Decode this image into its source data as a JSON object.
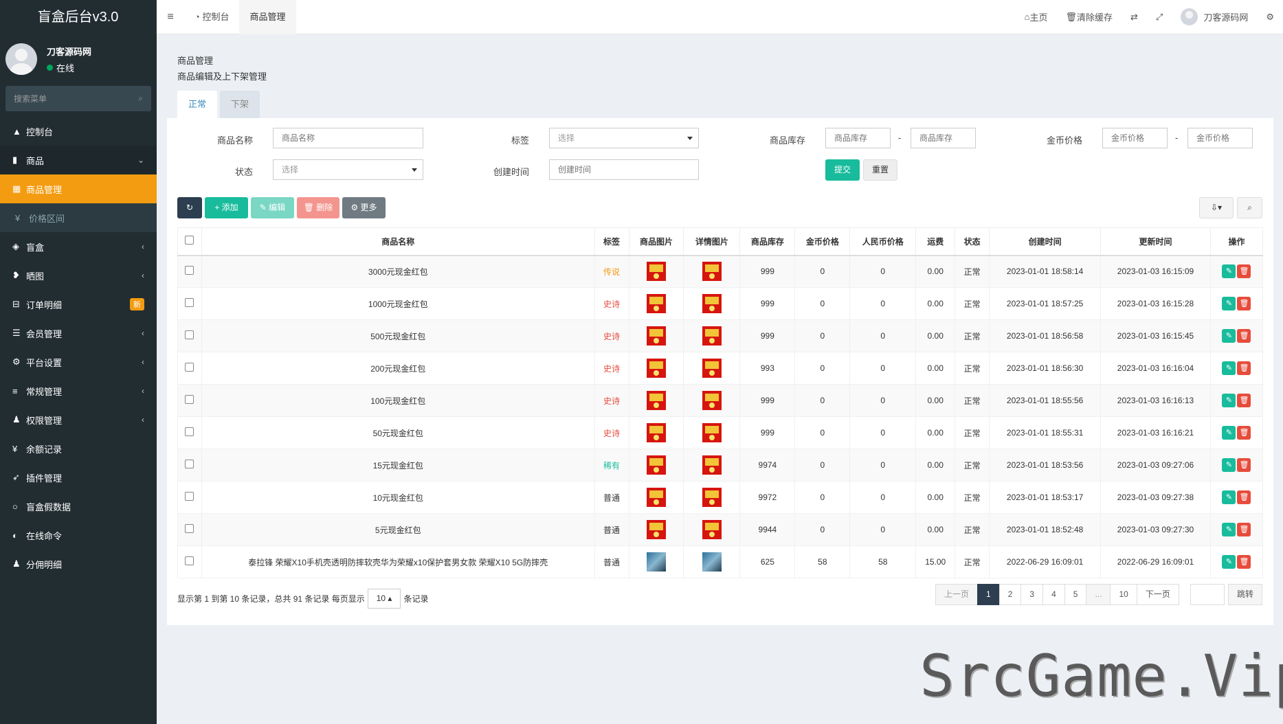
{
  "sidebar": {
    "app_title": "盲盒后台v3.0",
    "user_name": "刀客源码网",
    "user_status": "在线",
    "search_placeholder": "搜索菜单",
    "items": [
      {
        "icon": "▲",
        "label": "控制台",
        "arrow": ""
      },
      {
        "icon": "▮",
        "label": "商品",
        "arrow": "⌄"
      },
      {
        "icon": "▦",
        "label": "商品管理",
        "arrow": ""
      },
      {
        "icon": "¥",
        "label": "价格区间",
        "arrow": ""
      },
      {
        "icon": "◈",
        "label": "盲盒",
        "arrow": "‹"
      },
      {
        "icon": "❥",
        "label": "晒图",
        "arrow": "‹"
      },
      {
        "icon": "⊟",
        "label": "订单明细",
        "badge": "新"
      },
      {
        "icon": "☰",
        "label": "会员管理",
        "arrow": "‹"
      },
      {
        "icon": "⚙",
        "label": "平台设置",
        "arrow": "‹"
      },
      {
        "icon": "≡",
        "label": "常规管理",
        "arrow": "‹"
      },
      {
        "icon": "♟",
        "label": "权限管理",
        "arrow": "‹"
      },
      {
        "icon": "¥",
        "label": "余额记录",
        "arrow": ""
      },
      {
        "icon": "➶",
        "label": "插件管理",
        "arrow": ""
      },
      {
        "icon": "○",
        "label": "盲盒假数据",
        "arrow": ""
      },
      {
        "icon": "◐",
        "label": "在线命令",
        "arrow": ""
      },
      {
        "icon": "♟",
        "label": "分佣明细",
        "arrow": ""
      }
    ]
  },
  "header": {
    "tabs": [
      {
        "label": "控制台"
      },
      {
        "label": "商品管理"
      }
    ],
    "home": "主页",
    "clear_cache": "清除缓存",
    "user": "刀客源码网"
  },
  "content": {
    "title": "商品管理",
    "subtitle": "商品编辑及上下架管理",
    "subtabs": [
      "正常",
      "下架"
    ]
  },
  "filters": {
    "name_label": "商品名称",
    "name_placeholder": "商品名称",
    "tag_label": "标签",
    "tag_value": "选择",
    "stock_label": "商品库存",
    "stock_placeholder": "商品库存",
    "gold_label": "金币价格",
    "gold_placeholder": "金币价格",
    "status_label": "状态",
    "status_value": "选择",
    "created_label": "创建时间",
    "created_placeholder": "创建时间",
    "submit": "提交",
    "reset": "重置",
    "dash": "-"
  },
  "toolbar": {
    "add": "+ 添加",
    "edit": "✎ 编辑",
    "delete": "🗑 删除",
    "more": "⚙ 更多"
  },
  "table": {
    "columns": [
      "商品名称",
      "标签",
      "商品图片",
      "详情图片",
      "商品库存",
      "金币价格",
      "人民币价格",
      "运费",
      "状态",
      "创建时间",
      "更新时间",
      "操作"
    ],
    "rows": [
      {
        "name": "3000元现金红包",
        "tag": "传说",
        "tag_color": "orange",
        "img": "red",
        "stock": "999",
        "gold": "0",
        "rmb": "0",
        "ship": "0.00",
        "status": "正常",
        "created": "2023-01-01 18:58:14",
        "updated": "2023-01-03 16:15:09"
      },
      {
        "name": "1000元现金红包",
        "tag": "史诗",
        "tag_color": "red",
        "img": "red",
        "stock": "999",
        "gold": "0",
        "rmb": "0",
        "ship": "0.00",
        "status": "正常",
        "created": "2023-01-01 18:57:25",
        "updated": "2023-01-03 16:15:28"
      },
      {
        "name": "500元现金红包",
        "tag": "史诗",
        "tag_color": "red",
        "img": "red",
        "stock": "999",
        "gold": "0",
        "rmb": "0",
        "ship": "0.00",
        "status": "正常",
        "created": "2023-01-01 18:56:58",
        "updated": "2023-01-03 16:15:45"
      },
      {
        "name": "200元现金红包",
        "tag": "史诗",
        "tag_color": "red",
        "img": "red",
        "stock": "993",
        "gold": "0",
        "rmb": "0",
        "ship": "0.00",
        "status": "正常",
        "created": "2023-01-01 18:56:30",
        "updated": "2023-01-03 16:16:04"
      },
      {
        "name": "100元现金红包",
        "tag": "史诗",
        "tag_color": "red",
        "img": "red",
        "stock": "999",
        "gold": "0",
        "rmb": "0",
        "ship": "0.00",
        "status": "正常",
        "created": "2023-01-01 18:55:56",
        "updated": "2023-01-03 16:16:13"
      },
      {
        "name": "50元现金红包",
        "tag": "史诗",
        "tag_color": "red",
        "img": "red",
        "stock": "999",
        "gold": "0",
        "rmb": "0",
        "ship": "0.00",
        "status": "正常",
        "created": "2023-01-01 18:55:31",
        "updated": "2023-01-03 16:16:21"
      },
      {
        "name": "15元现金红包",
        "tag": "稀有",
        "tag_color": "green",
        "img": "red",
        "stock": "9974",
        "gold": "0",
        "rmb": "0",
        "ship": "0.00",
        "status": "正常",
        "created": "2023-01-01 18:53:56",
        "updated": "2023-01-03 09:27:06"
      },
      {
        "name": "10元现金红包",
        "tag": "普通",
        "tag_color": "normal",
        "img": "red",
        "stock": "9972",
        "gold": "0",
        "rmb": "0",
        "ship": "0.00",
        "status": "正常",
        "created": "2023-01-01 18:53:17",
        "updated": "2023-01-03 09:27:38"
      },
      {
        "name": "5元现金红包",
        "tag": "普通",
        "tag_color": "normal",
        "img": "red",
        "stock": "9944",
        "gold": "0",
        "rmb": "0",
        "ship": "0.00",
        "status": "正常",
        "created": "2023-01-01 18:52:48",
        "updated": "2023-01-03 09:27:30"
      },
      {
        "name": "泰拉锋 荣耀X10手机壳透明防摔软壳华为荣耀x10保护套男女款 荣耀X10 5G防摔壳",
        "tag": "普通",
        "tag_color": "normal",
        "img": "phone",
        "stock": "625",
        "gold": "58",
        "rmb": "58",
        "ship": "15.00",
        "status": "正常",
        "created": "2022-06-29 16:09:01",
        "updated": "2022-06-29 16:09:01"
      }
    ]
  },
  "pagination": {
    "info_prefix": "显示第 1 到第 10 条记录，总共 91 条记录 每页显示",
    "page_size": "10 ▴",
    "info_suffix": "条记录",
    "prev": "上一页",
    "pages": [
      "1",
      "2",
      "3",
      "4",
      "5",
      "...",
      "10"
    ],
    "next": "下一页",
    "jump": "跳转"
  },
  "watermark": "SrcGame.Vip",
  "colors": {
    "sidebar": "#222d32",
    "accent": "#f39c12",
    "primary": "#18bc9c",
    "danger": "#e74c3c"
  }
}
